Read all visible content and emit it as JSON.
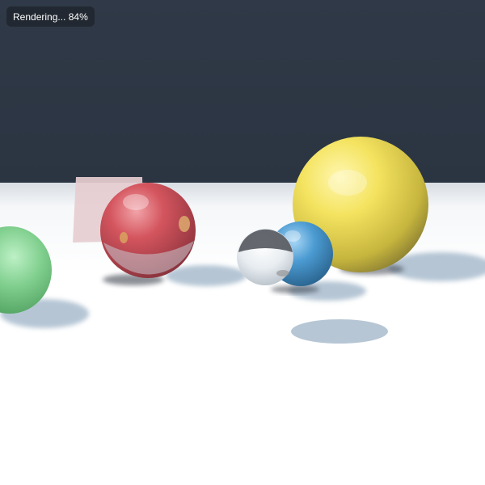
{
  "status": {
    "label": "Rendering...",
    "progress_text": "84%",
    "progress": 0.84
  },
  "scene": {
    "colors": {
      "sky": "#2e3846",
      "floor": "#ffffff",
      "shadow": "#9fb3c6",
      "red_sphere": "#d2545d",
      "yellow_sphere": "#f3e25f",
      "blue_sphere": "#4f9fd4",
      "green_sphere": "#7fcf8f",
      "glass_sphere": "#e9eef2",
      "pink_panel": "#e7cfd2"
    }
  }
}
